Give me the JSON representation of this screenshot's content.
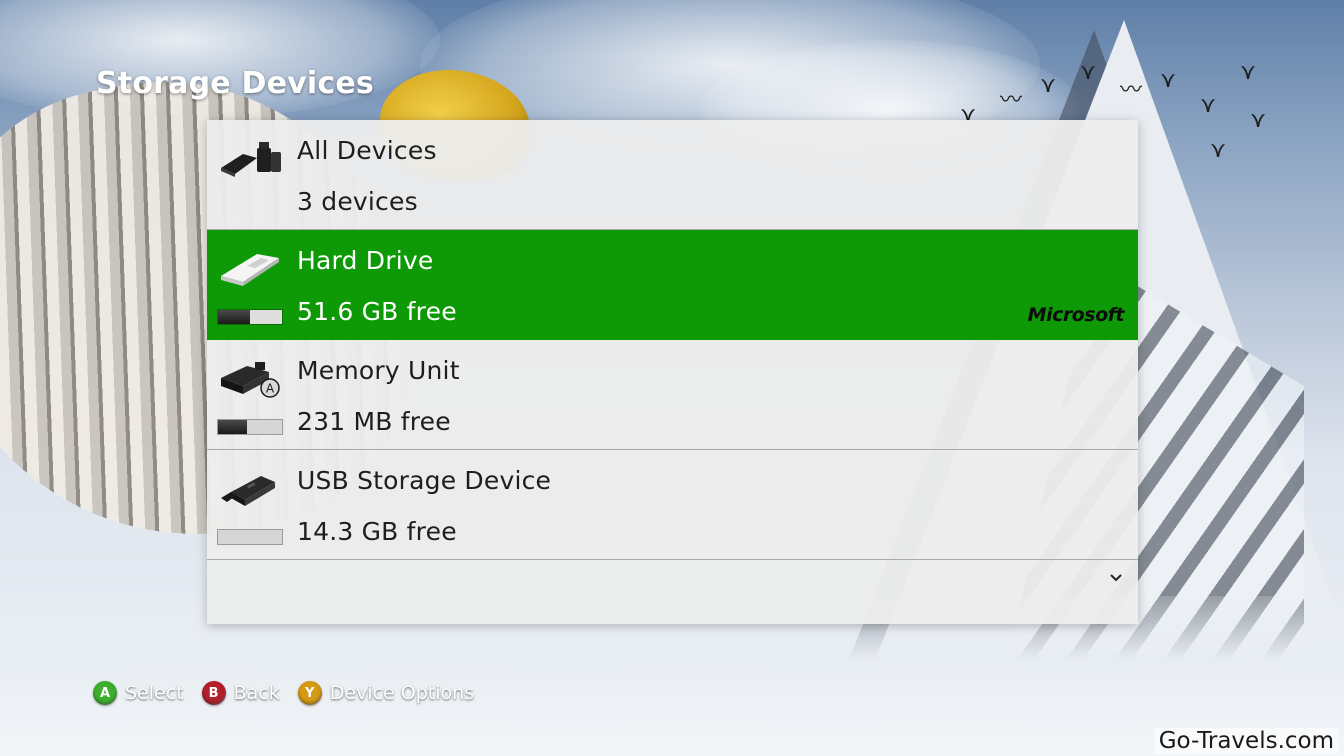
{
  "header": {
    "title": "Storage Devices"
  },
  "devices": [
    {
      "name": "All Devices",
      "detail": "3 devices",
      "icon": "all-devices-icon",
      "selected": false,
      "free_fraction": null
    },
    {
      "name": "Hard Drive",
      "detail": "51.6 GB free",
      "icon": "hard-drive-icon",
      "selected": true,
      "free_fraction": 0.5,
      "brand": "Microsoft"
    },
    {
      "name": "Memory Unit",
      "detail": "231 MB free",
      "icon": "memory-unit-icon",
      "selected": false,
      "free_fraction": 0.55,
      "badge": "A"
    },
    {
      "name": "USB Storage Device",
      "detail": "14.3 GB free",
      "icon": "usb-storage-icon",
      "selected": false,
      "free_fraction": 1.0
    }
  ],
  "footer": {
    "hints": [
      {
        "button": "A",
        "label": "Select",
        "color": "#3cb02b"
      },
      {
        "button": "B",
        "label": "Back",
        "color": "#b3202a"
      },
      {
        "button": "Y",
        "label": "Device Options",
        "color": "#d59a12"
      }
    ]
  },
  "watermark": "Go-Travels.com",
  "colors": {
    "selection": "#0d9a06",
    "panel": "#ececec"
  }
}
